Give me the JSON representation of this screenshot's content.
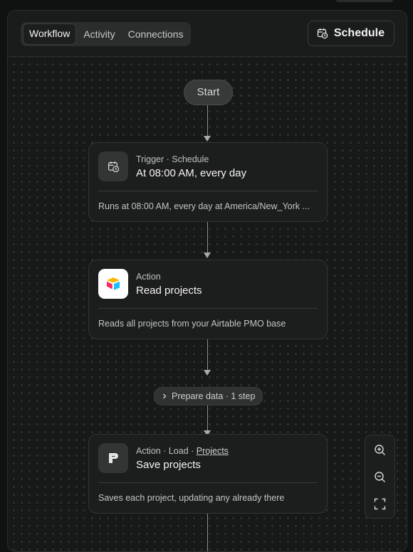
{
  "header": {
    "tabs": [
      {
        "label": "Workflow",
        "active": true
      },
      {
        "label": "Activity",
        "active": false
      },
      {
        "label": "Connections",
        "active": false
      }
    ],
    "schedule_button": {
      "label": "Schedule",
      "icon": "calendar-clock-icon"
    }
  },
  "flow": {
    "start_label": "Start",
    "nodes": [
      {
        "icon": "calendar-clock-icon",
        "meta": "Trigger · Schedule",
        "title": "At 08:00 AM, every day",
        "description": "Runs at 08:00 AM, every day at America/New_York ..."
      },
      {
        "icon": "airtable-logo-icon",
        "meta": "Action",
        "title": "Read projects",
        "description": "Reads all projects from your Airtable PMO base"
      },
      {
        "icon": "database-logo-icon",
        "meta_prefix": "Action · Load · ",
        "meta_link": "Projects",
        "title": "Save projects",
        "description": "Saves each project, updating any already there"
      }
    ],
    "prepare_step_label": "Prepare data · 1 step"
  },
  "zoom_controls": {
    "icons": [
      "zoom-in-icon",
      "zoom-out-icon",
      "fit-view-icon"
    ]
  },
  "colors": {
    "background": "#171918",
    "panel": "#1c1e1d",
    "border": "#313432",
    "text": "#f5f5f3"
  }
}
